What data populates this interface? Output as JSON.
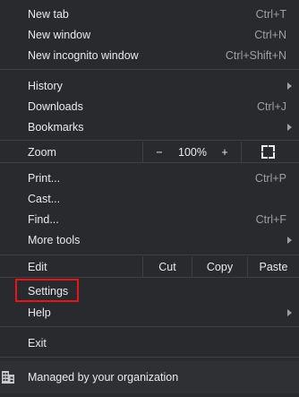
{
  "menu": {
    "new_tab": {
      "label": "New tab",
      "shortcut": "Ctrl+T"
    },
    "new_window": {
      "label": "New window",
      "shortcut": "Ctrl+N"
    },
    "new_incognito": {
      "label": "New incognito window",
      "shortcut": "Ctrl+Shift+N"
    },
    "history": {
      "label": "History"
    },
    "downloads": {
      "label": "Downloads",
      "shortcut": "Ctrl+J"
    },
    "bookmarks": {
      "label": "Bookmarks"
    },
    "zoom": {
      "label": "Zoom",
      "minus": "−",
      "level": "100%",
      "plus": "+"
    },
    "print": {
      "label": "Print...",
      "shortcut": "Ctrl+P"
    },
    "cast": {
      "label": "Cast..."
    },
    "find": {
      "label": "Find...",
      "shortcut": "Ctrl+F"
    },
    "more_tools": {
      "label": "More tools"
    },
    "edit": {
      "label": "Edit",
      "cut": "Cut",
      "copy": "Copy",
      "paste": "Paste"
    },
    "settings": {
      "label": "Settings"
    },
    "help": {
      "label": "Help"
    },
    "exit": {
      "label": "Exit"
    },
    "managed": {
      "label": "Managed by your organization"
    }
  },
  "colors": {
    "background": "#292a2d",
    "text": "#e8eaed",
    "shortcut": "#9aa0a6",
    "separator": "#3c4043",
    "highlight": "#e8131b"
  },
  "icons": {
    "fullscreen": "fullscreen-icon",
    "submenu": "chevron-right-icon",
    "managed": "building-icon"
  }
}
